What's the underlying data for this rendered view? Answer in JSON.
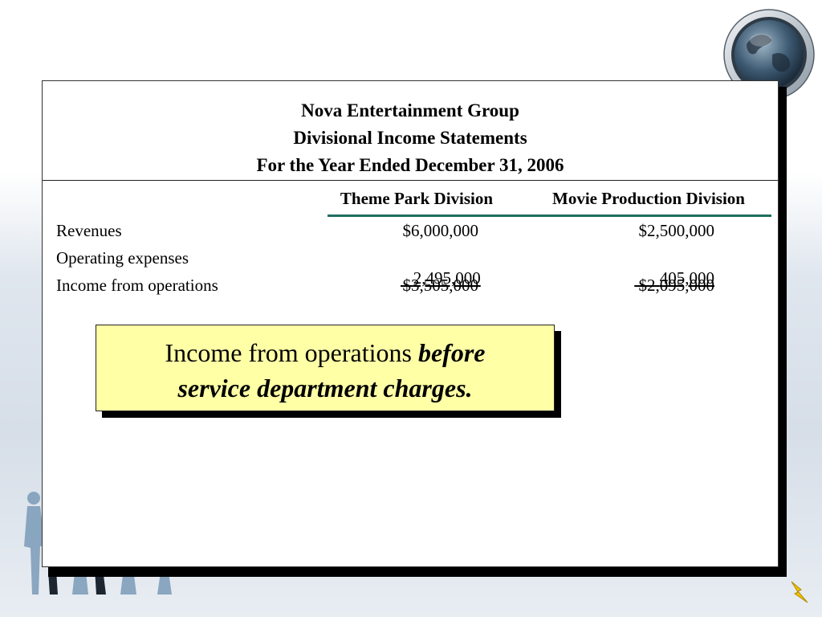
{
  "statement": {
    "company": "Nova Entertainment Group",
    "title": "Divisional Income Statements",
    "period": "For the Year Ended December 31, 2006"
  },
  "columns": [
    "Theme Park Division",
    "Movie Production Division"
  ],
  "rows": [
    {
      "label": "Revenues",
      "values": [
        "$6,000,000",
        "$2,500,000"
      ]
    },
    {
      "label": "Operating expenses",
      "values": [
        "2,495,000",
        "405,000"
      ]
    },
    {
      "label": "Income from operations",
      "values": [
        "$3,505,000",
        "$2,095,000"
      ]
    }
  ],
  "callout": {
    "text_plain": "Income from operations ",
    "text_emphasis_1": "before",
    "text_emphasis_2": "service department charges",
    "text_end": "."
  },
  "colors": {
    "column_rule": "#1f6e60",
    "callout_fill": "#ffffa6"
  },
  "icons": [
    "globe-icon",
    "people-silhouettes",
    "lightning-bolt-icon"
  ]
}
